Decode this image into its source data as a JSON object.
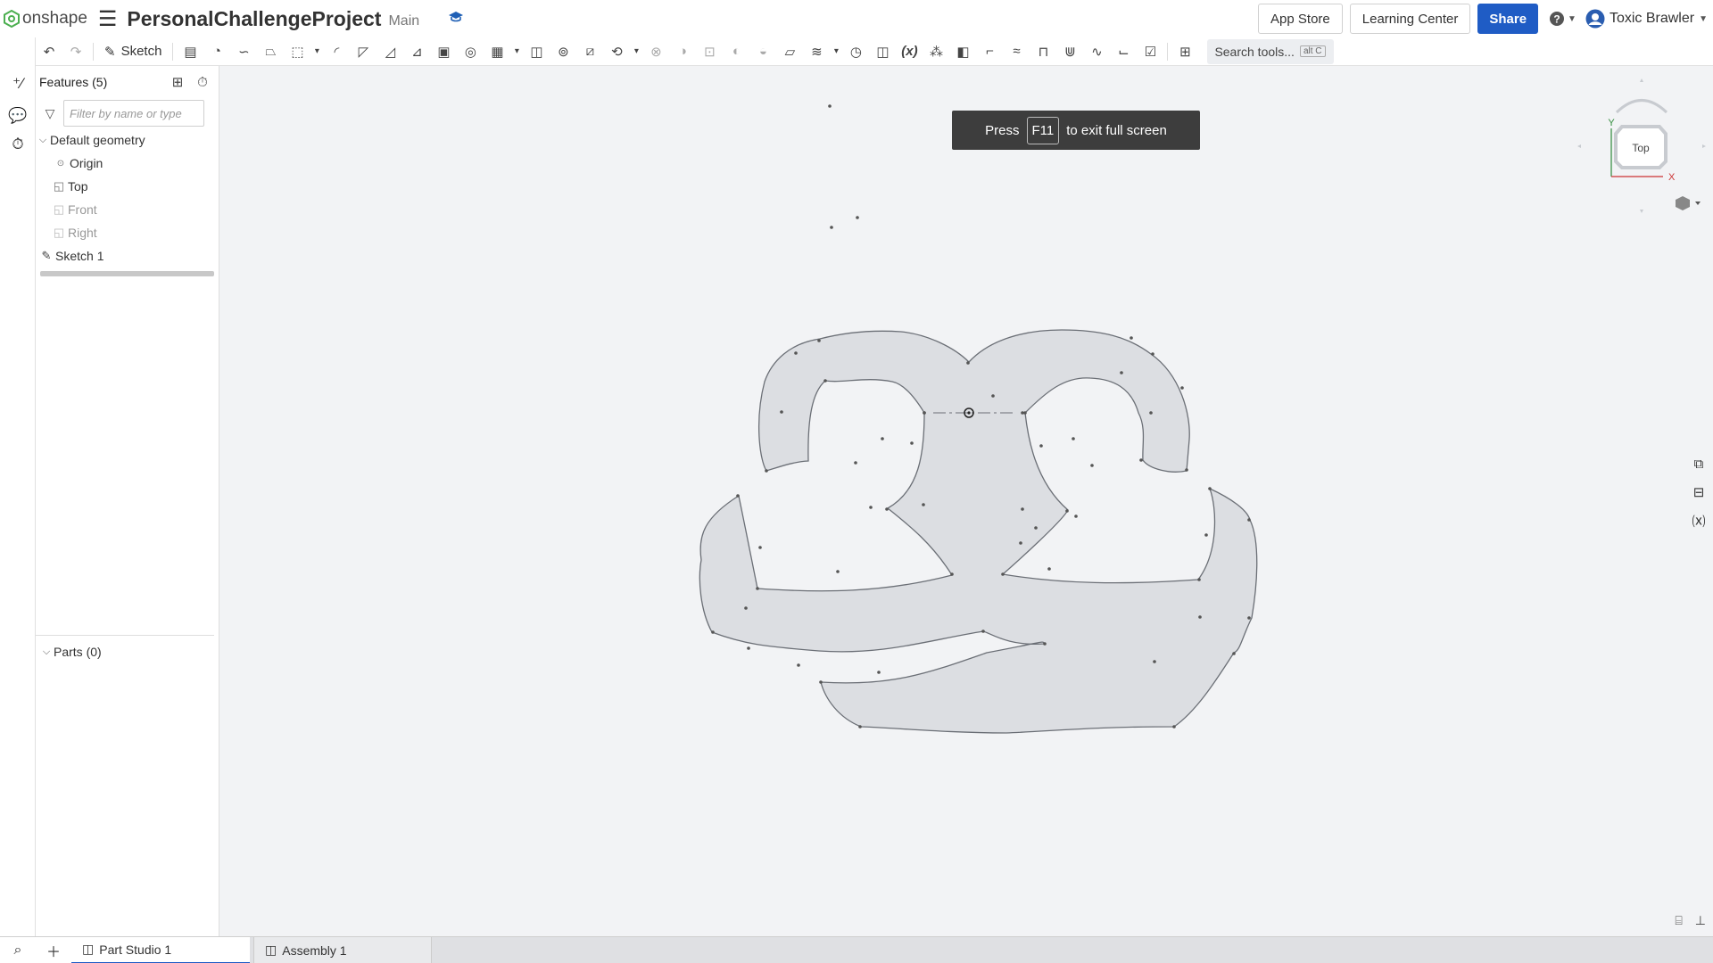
{
  "header": {
    "logo_text": "onshape",
    "doc_title": "PersonalChallengeProject",
    "branch": "Main",
    "app_store": "App Store",
    "learning_center": "Learning Center",
    "share": "Share",
    "user_name": "Toxic Brawler"
  },
  "toolbar": {
    "sketch_label": "Sketch",
    "search_placeholder": "Search tools...",
    "search_shortcut": "alt C"
  },
  "features": {
    "title": "Features (5)",
    "filter_placeholder": "Filter by name or type",
    "default_geometry": "Default geometry",
    "items": [
      "Origin",
      "Top",
      "Front",
      "Right"
    ],
    "sketch": "Sketch 1"
  },
  "parts": {
    "title": "Parts (0)"
  },
  "fullscreen_toast": {
    "before": "Press",
    "key": "F11",
    "after": "to exit full screen"
  },
  "view_cube": {
    "face": "Top",
    "axis_y": "Y",
    "axis_x": "X"
  },
  "tabs": [
    "Part Studio 1",
    "Assembly 1"
  ],
  "colors": {
    "accent": "#1f5cc5",
    "sketch_fill": "#dcdee2",
    "sketch_stroke": "#6b6f76"
  },
  "icons": {
    "menu": "hamburger-icon",
    "learn": "graduation-cap-icon",
    "help": "question-icon",
    "user": "avatar-icon"
  }
}
